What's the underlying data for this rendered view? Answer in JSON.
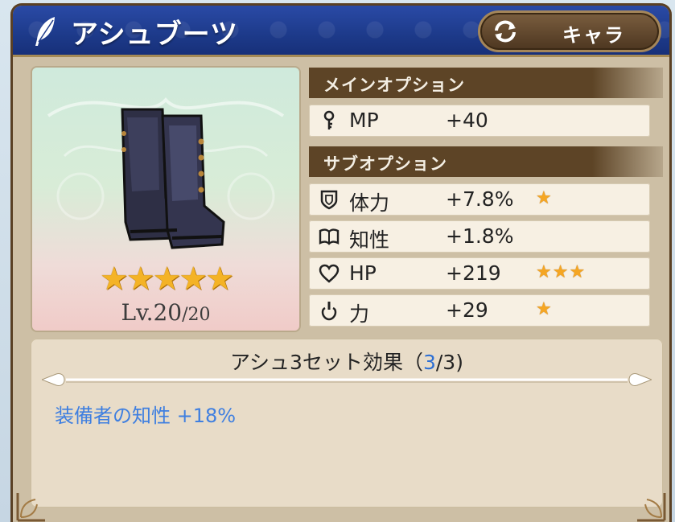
{
  "header": {
    "title": "アシュブーツ",
    "chara_button_label": "キャラ"
  },
  "item": {
    "rarity_stars": "★★★★★",
    "level_prefix": "Lv.20",
    "level_max": "/20"
  },
  "main_option": {
    "section_label": "メインオプション",
    "name": "MP",
    "value": "+40",
    "icon": "mp-key-icon"
  },
  "sub_option": {
    "section_label": "サブオプション",
    "rows": [
      {
        "name": "体力",
        "value": "+7.8%",
        "stars": "★",
        "icon": "shield-icon"
      },
      {
        "name": "知性",
        "value": "+1.8%",
        "stars": "",
        "icon": "book-icon"
      },
      {
        "name": "HP",
        "value": "+219",
        "stars": "★★★",
        "icon": "heart-icon"
      },
      {
        "name": "力",
        "value": "+29",
        "stars": "★",
        "icon": "power-icon"
      }
    ]
  },
  "set_bonus": {
    "title_prefix": "アシュ3セット効果（",
    "current": "3",
    "title_suffix": "/3)",
    "effect": "装備者の知性 +18%"
  },
  "colors": {
    "header_blue": "#1d3a8a",
    "frame_brown": "#5a4024",
    "star_gold": "#f5a623",
    "effect_blue": "#3f7fe0"
  }
}
